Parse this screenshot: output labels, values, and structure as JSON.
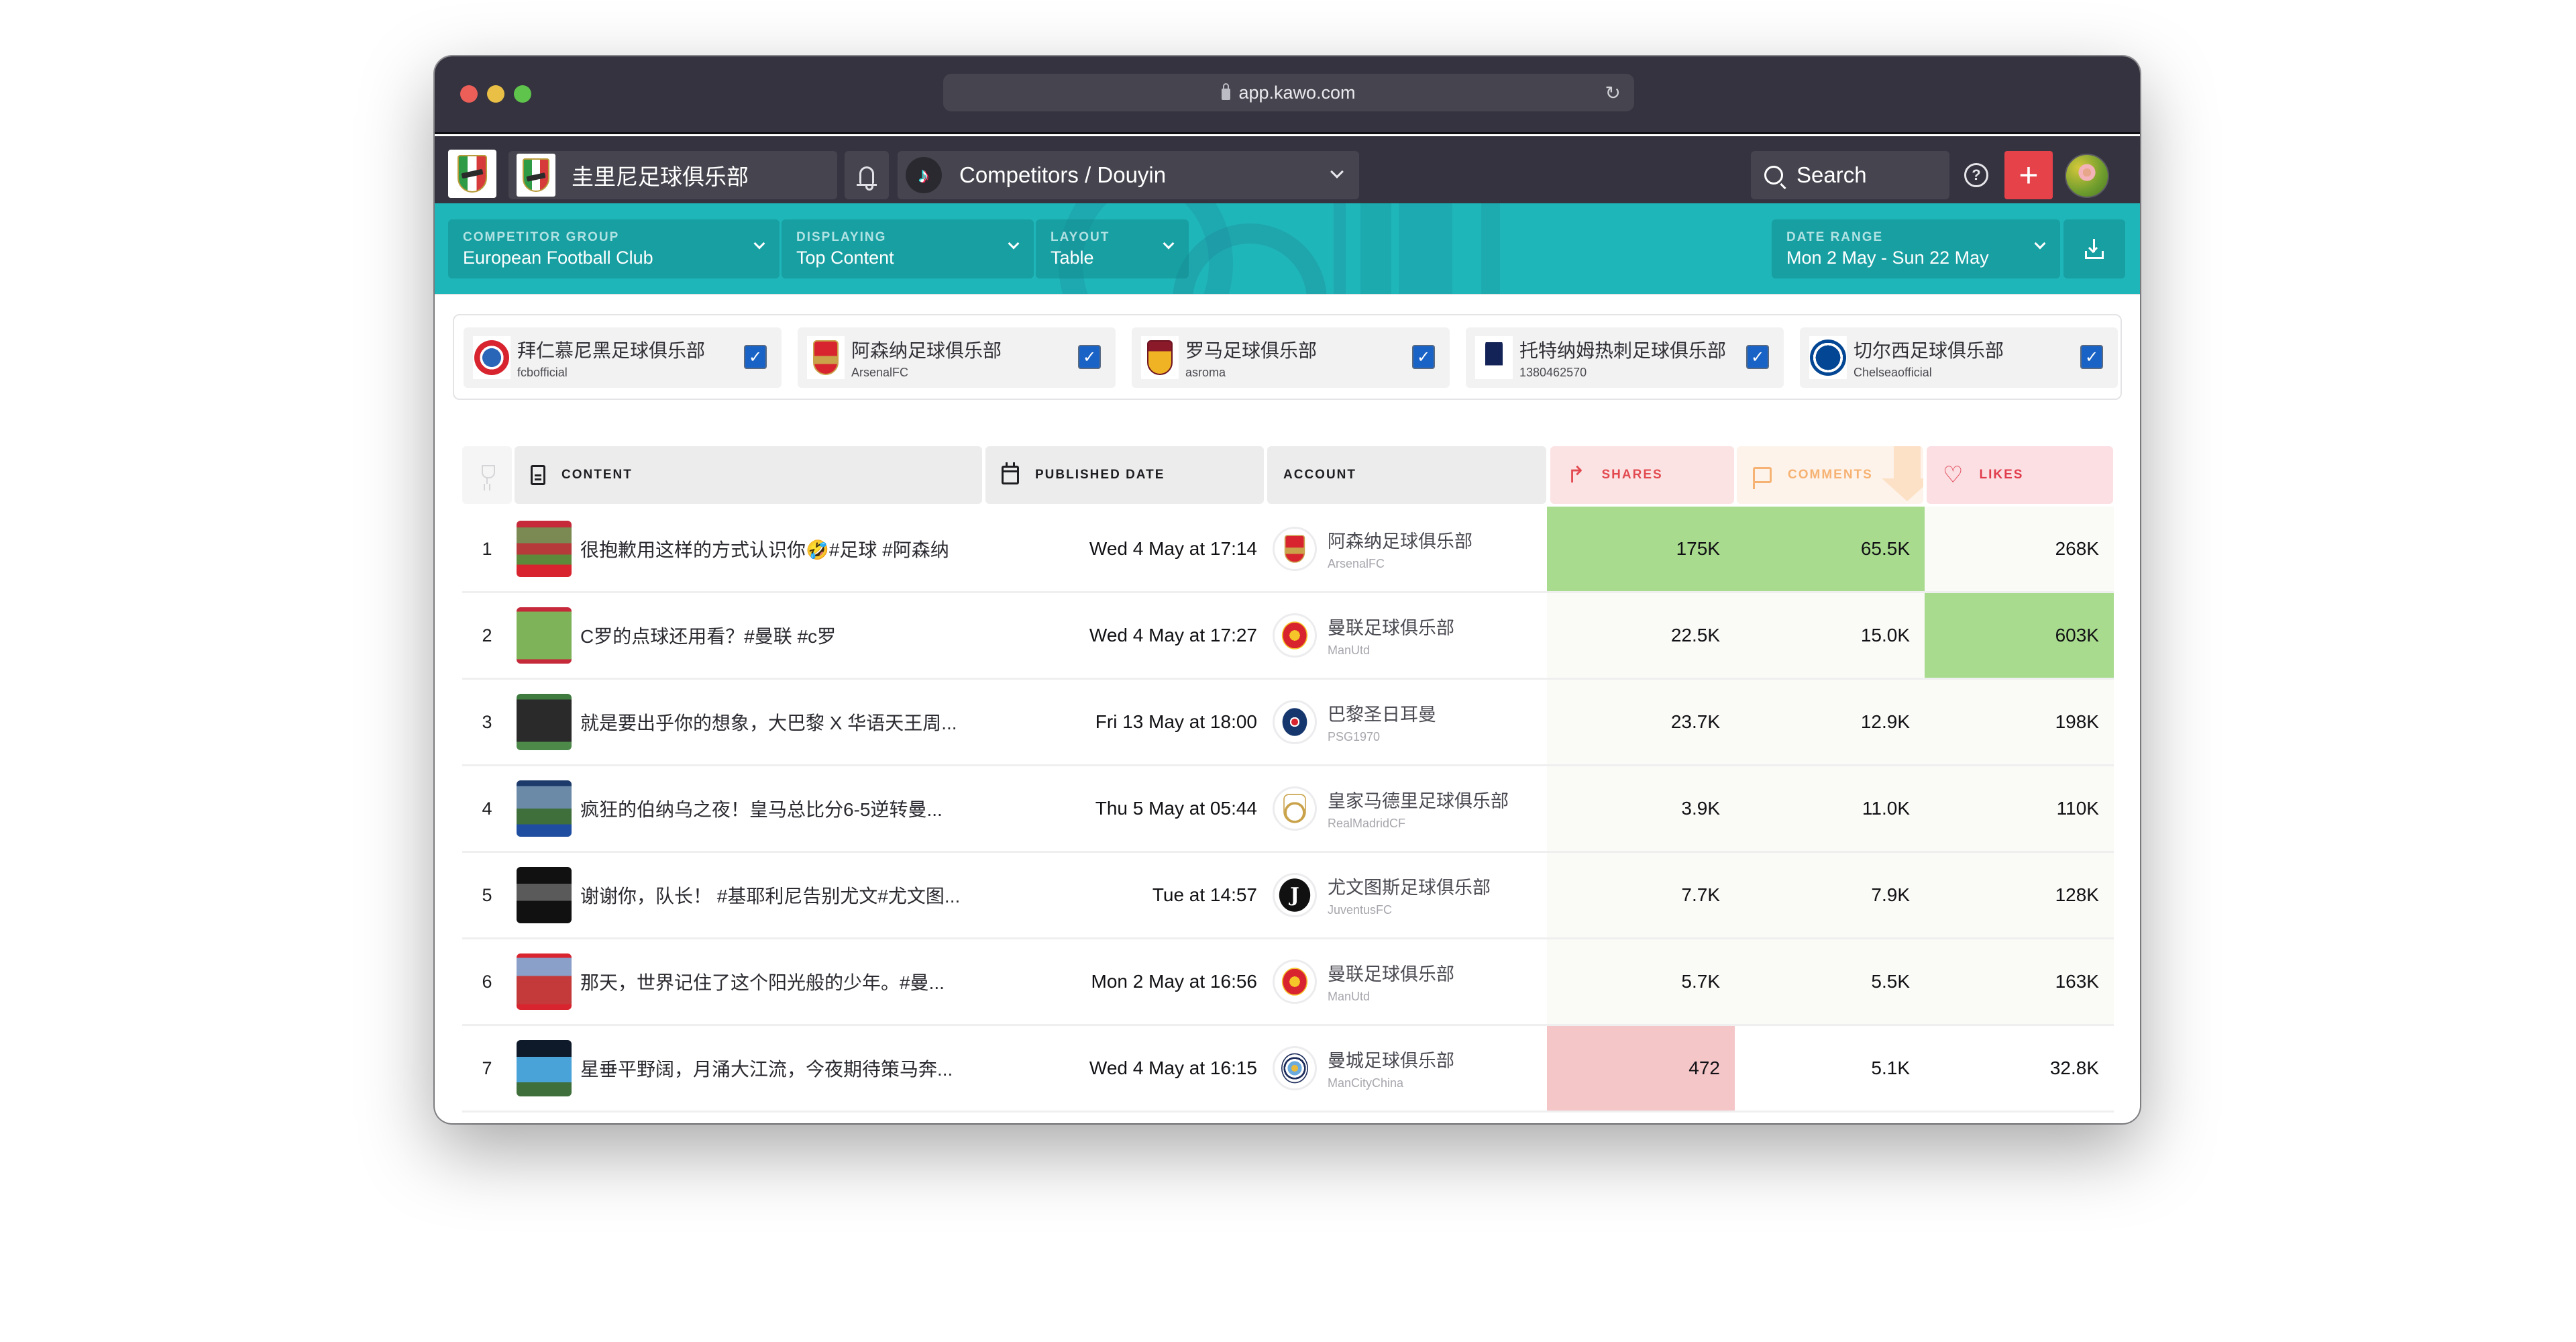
{
  "browser": {
    "url": "app.kawo.com"
  },
  "nav": {
    "organization": "圭里尼足球俱乐部",
    "channel": "Competitors / Douyin",
    "search_label": "Search",
    "help_icon": "question-circle-icon",
    "add_label": "+"
  },
  "filters": {
    "competitor_group": {
      "label": "COMPETITOR GROUP",
      "value": "European Football Club"
    },
    "displaying": {
      "label": "DISPLAYING",
      "value": "Top Content"
    },
    "layout": {
      "label": "LAYOUT",
      "value": "Table"
    },
    "date_range": {
      "label": "DATE RANGE",
      "value": "Mon 2 May - Sun 22 May"
    }
  },
  "competitors": [
    {
      "name": "拜仁慕尼黑足球俱乐部",
      "handle": "fcbofficial",
      "checked": true,
      "badge": "bayern"
    },
    {
      "name": "阿森纳足球俱乐部",
      "handle": "ArsenalFC",
      "checked": true,
      "badge": "arsenal"
    },
    {
      "name": "罗马足球俱乐部",
      "handle": "asroma",
      "checked": true,
      "badge": "roma"
    },
    {
      "name": "托特纳姆热刺足球俱乐部",
      "handle": "1380462570",
      "checked": true,
      "badge": "spurs"
    },
    {
      "name": "切尔西足球俱乐部",
      "handle": "Chelseaofficial",
      "checked": true,
      "badge": "chelsea"
    }
  ],
  "table": {
    "headers": {
      "content": "CONTENT",
      "published_date": "PUBLISHED DATE",
      "account": "ACCOUNT",
      "shares": "SHARES",
      "comments": "COMMENTS",
      "likes": "LIKES"
    },
    "sorted_by": "comments",
    "sort_direction": "descending",
    "colors": {
      "top_highlight": "#a8db8d",
      "low_highlight": "#f5c6c8",
      "shares_header": "#e24a50",
      "comments_header": "#f6b273",
      "likes_header": "#e03c4c"
    },
    "rows": [
      {
        "rank": "1",
        "content": "很抱歉用这样的方式认识你🤣#足球 #阿森纳",
        "date": "Wed 4 May at 17:14",
        "account": "阿森纳足球俱乐部",
        "handle": "ArsenalFC",
        "badge": "arsenal",
        "shares": "175K",
        "comments": "65.5K",
        "likes": "268K",
        "highlight": {
          "shares": "green",
          "comments": "green",
          "likes": "faint"
        }
      },
      {
        "rank": "2",
        "content": "C罗的点球还用看？#曼联 #c罗",
        "date": "Wed 4 May at 17:27",
        "account": "曼联足球俱乐部",
        "handle": "ManUtd",
        "badge": "manutd",
        "shares": "22.5K",
        "comments": "15.0K",
        "likes": "603K",
        "highlight": {
          "shares": "faint",
          "comments": "faint",
          "likes": "green"
        }
      },
      {
        "rank": "3",
        "content": "就是要出乎你的想象，大巴黎 X 华语天王周...",
        "date": "Fri 13 May at 18:00",
        "account": "巴黎圣日耳曼",
        "handle": "PSG1970",
        "badge": "psg",
        "shares": "23.7K",
        "comments": "12.9K",
        "likes": "198K",
        "highlight": {
          "shares": "faint",
          "comments": "faint",
          "likes": "faint"
        }
      },
      {
        "rank": "4",
        "content": "疯狂的伯纳乌之夜！皇马总比分6-5逆转曼...",
        "date": "Thu 5 May at 05:44",
        "account": "皇家马德里足球俱乐部",
        "handle": "RealMadridCF",
        "badge": "real",
        "shares": "3.9K",
        "comments": "11.0K",
        "likes": "110K",
        "highlight": {
          "shares": "faint",
          "comments": "faint",
          "likes": "faint"
        }
      },
      {
        "rank": "5",
        "content": "谢谢你，队长！ #基耶利尼告别尤文#尤文图...",
        "date": "Tue at 14:57",
        "account": "尤文图斯足球俱乐部",
        "handle": "JuventusFC",
        "badge": "juve",
        "shares": "7.7K",
        "comments": "7.9K",
        "likes": "128K",
        "highlight": {
          "shares": "faint",
          "comments": "faint",
          "likes": "faint"
        }
      },
      {
        "rank": "6",
        "content": "那天，世界记住了这个阳光般的少年。#曼...",
        "date": "Mon 2 May at 16:56",
        "account": "曼联足球俱乐部",
        "handle": "ManUtd",
        "badge": "manutd",
        "shares": "5.7K",
        "comments": "5.5K",
        "likes": "163K",
        "highlight": {
          "shares": "faint",
          "comments": "faint",
          "likes": "faint"
        }
      },
      {
        "rank": "7",
        "content": "星垂平野阔，月涌大江流，今夜期待策马奔...",
        "date": "Wed 4 May at 16:15",
        "account": "曼城足球俱乐部",
        "handle": "ManCityChina",
        "badge": "mancity",
        "shares": "472",
        "comments": "5.1K",
        "likes": "32.8K",
        "highlight": {
          "shares": "red",
          "comments": "none",
          "likes": "none"
        }
      }
    ]
  }
}
